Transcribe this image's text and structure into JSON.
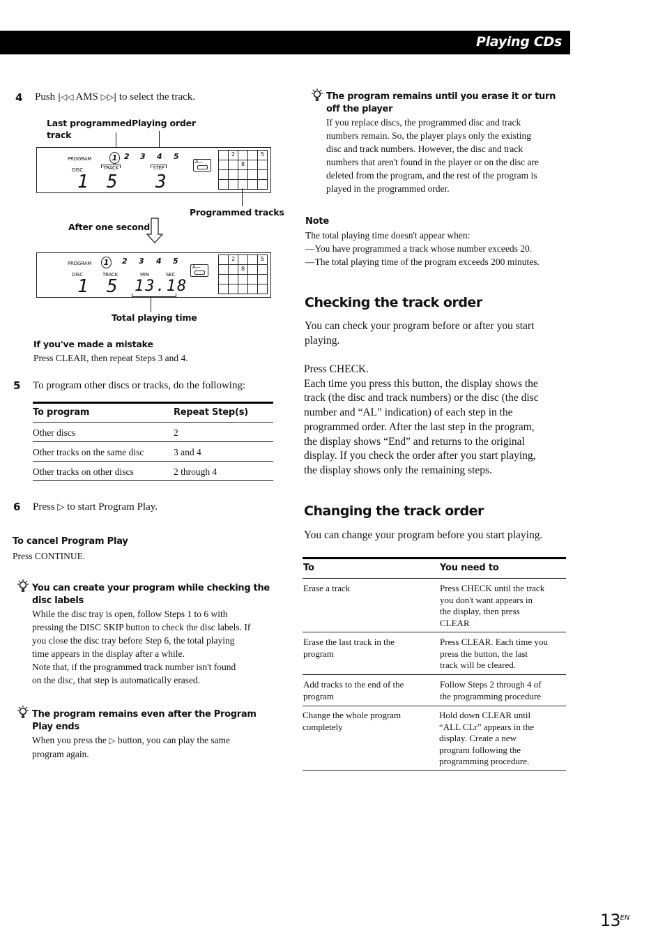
{
  "header": {
    "section_title": "Playing CDs"
  },
  "left_column": {
    "step4": {
      "number": "4",
      "text_before": "Push",
      "prev_icon": "|◁◁",
      "ams": "AMS",
      "next_icon": "▷▷|",
      "text_after": "to select the track."
    },
    "diagram1": {
      "callout_last_programmed": "Last programmed",
      "callout_track": "track",
      "callout_playing_order": "Playing order",
      "callout_programmed_tracks": "Programmed tracks",
      "lcd": {
        "program_label": "PROGRAM",
        "disc_label": "DISC",
        "track_label": "TRACK",
        "step_label": "STEP",
        "sequence": [
          "1",
          "2",
          "3",
          "4",
          "5"
        ],
        "disc_value": "1",
        "track_value": "5",
        "step_value": "3",
        "cassette_label": "A—",
        "grid_cells": [
          "",
          "2",
          "",
          "",
          "5",
          "",
          "",
          "8",
          "",
          "",
          "",
          "",
          "",
          "",
          "",
          "",
          "",
          "",
          "",
          ""
        ]
      }
    },
    "after_one_second": "After one second",
    "diagram2": {
      "callout_total_time": "Total playing time",
      "lcd": {
        "program_label": "PROGRAM",
        "disc_label": "DISC",
        "track_label": "TRACK",
        "min_label": "MIN",
        "sec_label": "SEC",
        "sequence": [
          "1",
          "2",
          "3",
          "4",
          "5"
        ],
        "disc_value": "1",
        "track_value": "5",
        "time_value": "13.18",
        "cassette_label": "A—",
        "grid_cells": [
          "",
          "2",
          "",
          "",
          "5",
          "",
          "",
          "8",
          "",
          "",
          "",
          "",
          "",
          "",
          "",
          "",
          "",
          "",
          "",
          ""
        ]
      }
    },
    "mistake": {
      "heading": "If you've made a mistake",
      "body": "Press CLEAR, then repeat Steps 3 and 4."
    },
    "step5": {
      "number": "5",
      "text": "To program other discs or tracks, do the following:"
    },
    "program_table": {
      "headers": [
        "To program",
        "Repeat Step(s)"
      ],
      "rows": [
        [
          "Other discs",
          "2"
        ],
        [
          "Other tracks on the same disc",
          "3 and 4"
        ],
        [
          "Other tracks on other discs",
          "2 through 4"
        ]
      ]
    },
    "step6": {
      "number": "6",
      "text_before": "Press",
      "play_icon": "▷",
      "text_after": "to start Program Play."
    },
    "cancel": {
      "heading": "To cancel Program Play",
      "body": "Press CONTINUE."
    },
    "tip1": {
      "icon": "lightbulb-icon",
      "heading": "You can create your program while checking the disc labels",
      "body": [
        "While the disc tray is open, follow Steps 1 to 6 with",
        "pressing the DISC SKIP button to check the disc labels. If",
        "you close the disc tray before Step 6, the total playing",
        "time appears in the display after a while.",
        "Note that, if the programmed track number isn't found",
        "on the disc, that step is automatically erased."
      ]
    },
    "tip2": {
      "icon": "lightbulb-icon",
      "heading": "The program remains even after the Program Play ends",
      "body_before": "When you press the",
      "play_icon": "▷",
      "body_after": "button, you can play the same",
      "body_line2": "program again."
    }
  },
  "right_column": {
    "tip3": {
      "icon": "lightbulb-icon",
      "heading": "The program remains until you erase it or turn off the player",
      "body": [
        "If you replace discs, the programmed disc and track",
        "numbers remain. So, the player plays only the existing",
        "disc and track numbers. However, the disc and track",
        "numbers that aren't found in the player or on the disc are",
        "deleted from the program, and the rest of the program is",
        "played in the programmed order."
      ]
    },
    "note": {
      "heading": "Note",
      "lines": [
        "The total playing time doesn't appear when:",
        "—You have programmed a track whose number exceeds 20.",
        "—The total playing time of the program exceeds 200 minutes."
      ]
    },
    "checking": {
      "heading": "Checking the track order",
      "intro": [
        "You can check your program before or after you start",
        "playing."
      ],
      "press": "Press CHECK.",
      "body": [
        "Each time you press this button, the display shows the",
        "track (the disc and track numbers) or the disc (the disc",
        "number and “AL” indication) of each step in the",
        "programmed order. After the last step in the program,",
        "the display shows “End” and returns to the original",
        "display. If you check the order after you start playing,",
        "the display shows only the remaining steps."
      ]
    },
    "changing": {
      "heading": "Changing the track order",
      "intro": "You can change your program before you start playing.",
      "table": {
        "headers": [
          "To",
          "You need to"
        ],
        "rows": [
          {
            "to": [
              "Erase a track"
            ],
            "action": [
              "Press CHECK until the track",
              "you don't want appears in",
              "the display, then press",
              "CLEAR"
            ]
          },
          {
            "to": [
              "Erase the last track in the",
              "program"
            ],
            "action": [
              "Press CLEAR. Each time you",
              "press the button, the last",
              "track will be cleared."
            ]
          },
          {
            "to": [
              "Add tracks to the end of the",
              "program"
            ],
            "action": [
              "Follow Steps 2 through 4 of",
              "the programming procedure"
            ]
          },
          {
            "to": [
              "Change the whole program",
              "completely"
            ],
            "action": [
              "Hold down CLEAR until",
              "“ALL CLr” appears in the",
              "display. Create a new",
              "program following the",
              "programming procedure."
            ]
          }
        ]
      }
    }
  },
  "footer": {
    "page_number": "13",
    "page_suffix": "EN"
  }
}
